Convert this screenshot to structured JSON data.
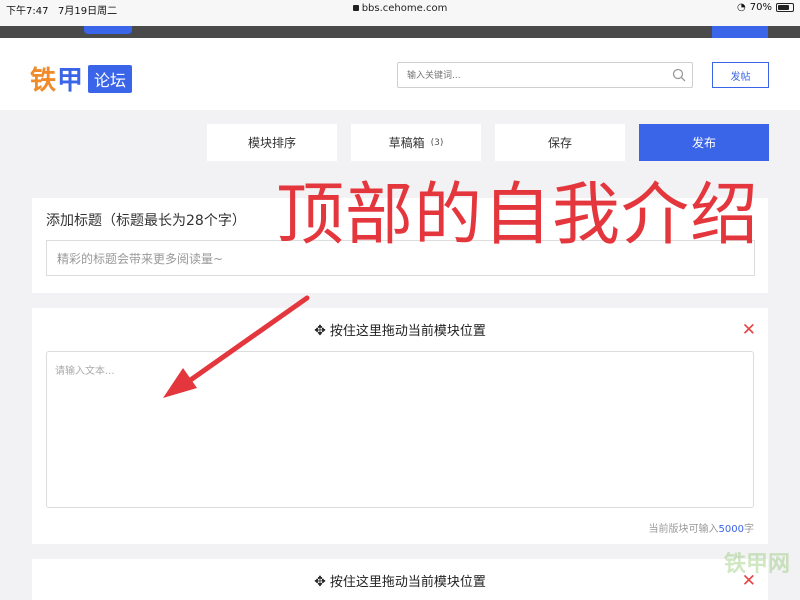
{
  "status": {
    "time": "下午7:47",
    "date": "7月19日周二",
    "url": "bbs.cehome.com",
    "battery": "70%",
    "battery_level": 0.7
  },
  "header": {
    "logo_main_a": "铁",
    "logo_main_b": "甲",
    "logo_tag": "论坛",
    "search_placeholder": "输入关键词...",
    "post_button": "发帖"
  },
  "toolbar": {
    "sort": "模块排序",
    "drafts": "草稿箱",
    "drafts_count": "(3)",
    "save": "保存",
    "publish": "发布"
  },
  "title_card": {
    "label": "添加标题（标题最长为28个字）",
    "placeholder": "精彩的标题会带来更多阅读量~"
  },
  "module1": {
    "drag_text": "按住这里拖动当前模块位置",
    "placeholder": "请输入文本...",
    "counter_prefix": "当前版块可输入",
    "counter_num": "5000",
    "counter_suffix": "字"
  },
  "module2": {
    "drag_text": "按住这里拖动当前模块位置"
  },
  "annotation": "顶部的自我介绍",
  "watermark": "铁甲网",
  "colors": {
    "accent": "#3a65e8",
    "logo_orange": "#f08a2a",
    "annotation_red": "#e4373d",
    "close_red": "#e54545"
  }
}
